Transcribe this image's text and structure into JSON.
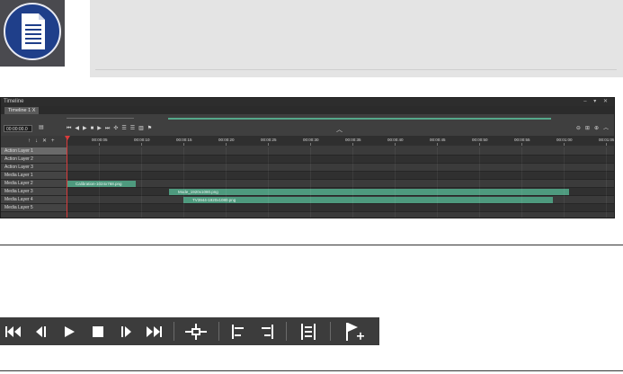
{
  "timeline": {
    "window_title": "Timeline",
    "window_controls": "– ▾ ✕",
    "tab_label": "Timeline 1",
    "tab_close": "X",
    "time_value": "00:00:00.0",
    "ruler_labels": [
      "00:00:05",
      "00:00:10",
      "00:00:15",
      "00:00:20",
      "00:00:25",
      "00:00:30",
      "00:00:35",
      "00:00:40",
      "00:00:45",
      "00:00:50",
      "00:00:55",
      "00:01:00",
      "00:01:05"
    ],
    "layers": [
      {
        "name": "Action Layer 1"
      },
      {
        "name": "Action Layer 2"
      },
      {
        "name": "Action Layer 3"
      },
      {
        "name": "Media Layer 1"
      },
      {
        "name": "Media Layer 2"
      },
      {
        "name": "Media Layer 3"
      },
      {
        "name": "Media Layer 4"
      },
      {
        "name": "Media Layer 5"
      }
    ],
    "clips": [
      {
        "label": "Calibration-1024x768.png"
      },
      {
        "label": "Mode_1920x1080.png"
      },
      {
        "label": "TV3944-1920x1080.png"
      }
    ]
  },
  "icons": {
    "note": "document-note-icon"
  },
  "colors": {
    "clip": "#4e9a7e",
    "playhead": "#d93b3b",
    "note_circle": "#1f3f8a"
  }
}
